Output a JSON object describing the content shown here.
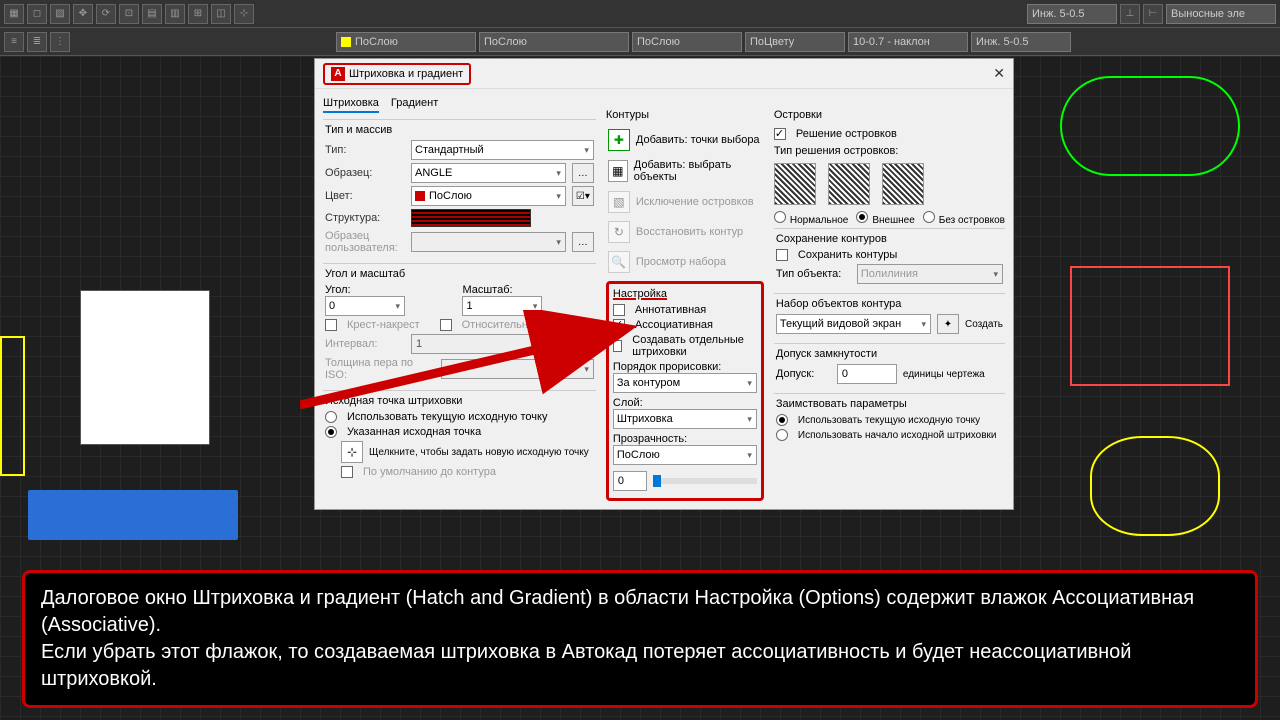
{
  "toolbar1": {
    "drops": [
      "Инж. 5-0.5",
      "Выносные эле"
    ]
  },
  "toolbar2": {
    "drops": [
      "ПоСлою",
      "ПоСлою",
      "ПоСлою",
      "ПоЦвету",
      "10-0.7 - наклон",
      "Инж. 5-0.5"
    ]
  },
  "dialog": {
    "title": "Штриховка и градиент",
    "tabs": [
      "Штриховка",
      "Градиент"
    ],
    "type_array": "Тип и массив",
    "type": "Тип:",
    "type_val": "Стандартный",
    "sample": "Образец:",
    "sample_val": "ANGLE",
    "color": "Цвет:",
    "color_val": "ПоСлою",
    "struct": "Структура:",
    "user_sample": "Образец пользователя:",
    "angle_scale": "Угол и масштаб",
    "angle": "Угол:",
    "angle_val": "0",
    "scale": "Масштаб:",
    "scale_val": "1",
    "cross": "Крест-накрест",
    "rel_sheet": "Относительно листа",
    "interval": "Интервал:",
    "interval_val": "1",
    "pen_iso": "Толщина пера по ISO:",
    "origin": "Исходная точка штриховки",
    "use_current": "Использовать текущую исходную точку",
    "use_spec": "Указанная исходная точка",
    "click_set": "Щелкните, чтобы задать новую исходную точку",
    "default_bounds": "По умолчанию до контура",
    "contours": "Контуры",
    "add_points": "Добавить: точки выбора",
    "add_select": "Добавить: выбрать объекты",
    "excl": "Исключение островков",
    "restore": "Восстановить контур",
    "preview": "Просмотр набора",
    "options": "Настройка",
    "annot": "Аннотативная",
    "assoc": "Ассоциативная",
    "create_sep": "Создавать отдельные штриховки",
    "draw_order": "Порядок прорисовки:",
    "draw_order_val": "За контуром",
    "layer": "Слой:",
    "layer_val": "Штриховка",
    "transp": "Прозрачность:",
    "transp_val": "ПоСлою",
    "transp_num": "0",
    "islands": "Островки",
    "island_detect": "Решение островков",
    "island_type": "Тип решения островков:",
    "isl_normal": "Нормальное",
    "isl_outer": "Внешнее",
    "isl_none": "Без островков",
    "save_cont": "Сохранение контуров",
    "save_cb": "Сохранить контуры",
    "obj_type": "Тип объекта:",
    "obj_type_val": "Полилиния",
    "cont_set": "Набор объектов контура",
    "cont_set_val": "Текущий видовой экран",
    "create": "Создать",
    "gap_tol": "Допуск замкнутости",
    "tol": "Допуск:",
    "tol_val": "0",
    "units": "единицы чертежа",
    "inherit": "Заимствовать параметры",
    "inh_cur": "Использовать текущую исходную точку",
    "inh_origin": "Использовать начало исходной штриховки"
  },
  "annotation": {
    "l1": "Далоговое окно Штриховка и градиент (Hatch and Gradient) в области Настройка (Options) содержит влажок Ассоциативная (Associative).",
    "l2": "Если убрать этот флажок, то создаваемая штриховка в Автокад потеряет ассоциативность и будет неассоциативной штриховкой."
  }
}
